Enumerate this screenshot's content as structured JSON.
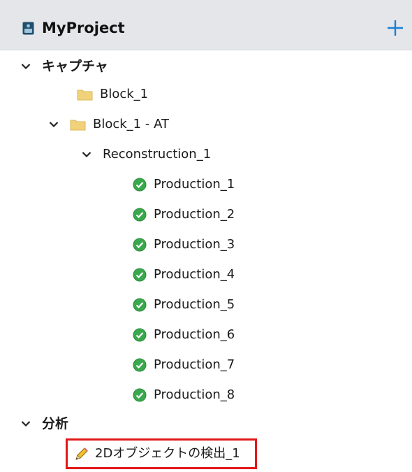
{
  "header": {
    "title": "MyProject",
    "icon": "project-icon",
    "add_icon": "plus-icon",
    "accent_color": "#1a7fd6"
  },
  "tree": {
    "capture_group": {
      "label": "キャプチャ",
      "expanded": true
    },
    "block_1": {
      "label": "Block_1",
      "icon": "folder-icon"
    },
    "block_1_at": {
      "label": "Block_1 - AT",
      "icon": "folder-icon",
      "expanded": true
    },
    "reconstruction_1": {
      "label": "Reconstruction_1",
      "expanded": true
    },
    "productions": [
      {
        "label": "Production_1",
        "status": "completed"
      },
      {
        "label": "Production_2",
        "status": "completed"
      },
      {
        "label": "Production_3",
        "status": "completed"
      },
      {
        "label": "Production_4",
        "status": "completed"
      },
      {
        "label": "Production_5",
        "status": "completed"
      },
      {
        "label": "Production_6",
        "status": "completed"
      },
      {
        "label": "Production_7",
        "status": "completed"
      },
      {
        "label": "Production_8",
        "status": "completed"
      }
    ],
    "analysis_group": {
      "label": "分析",
      "expanded": true
    },
    "detection_item": {
      "label": "2Dオブジェクトの検出_1",
      "icon": "pencil-icon",
      "highlighted": true
    }
  },
  "colors": {
    "status_completed": "#3aa84c",
    "folder": "#f1d27a",
    "highlight_border": "#e01818"
  }
}
